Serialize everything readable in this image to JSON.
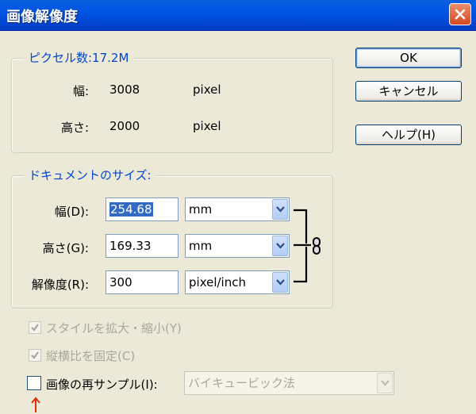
{
  "window": {
    "title": "画像解像度",
    "close_icon": "close-icon"
  },
  "pixel_dimensions": {
    "legend": "ピクセル数:17.2M",
    "width": {
      "label": "幅:",
      "value": "3008",
      "unit": "pixel"
    },
    "height": {
      "label": "高さ:",
      "value": "2000",
      "unit": "pixel"
    }
  },
  "buttons": {
    "ok": "OK",
    "cancel": "キャンセル",
    "help": "ヘルプ(H)"
  },
  "document_size": {
    "legend": "ドキュメントのサイズ:",
    "width": {
      "label": "幅(D):",
      "value": "254.68",
      "unit": "mm"
    },
    "height": {
      "label": "高さ(G):",
      "value": "169.33",
      "unit": "mm"
    },
    "resolution": {
      "label": "解像度(R):",
      "value": "300",
      "unit": "pixel/inch"
    }
  },
  "options": {
    "scale_styles": {
      "label": "スタイルを拡大・縮小(Y)",
      "checked": true,
      "enabled": false
    },
    "constrain_proportions": {
      "label": "縦横比を固定(C)",
      "checked": true,
      "enabled": false
    },
    "resample": {
      "label": "画像の再サンプル(I):",
      "checked": false,
      "enabled": true
    },
    "resample_method": {
      "value": "バイキュービック法",
      "enabled": false
    }
  },
  "colors": {
    "title_bar": "#0054e3",
    "legend_text": "#0046d5",
    "annotation_arrow": "#e03010"
  }
}
